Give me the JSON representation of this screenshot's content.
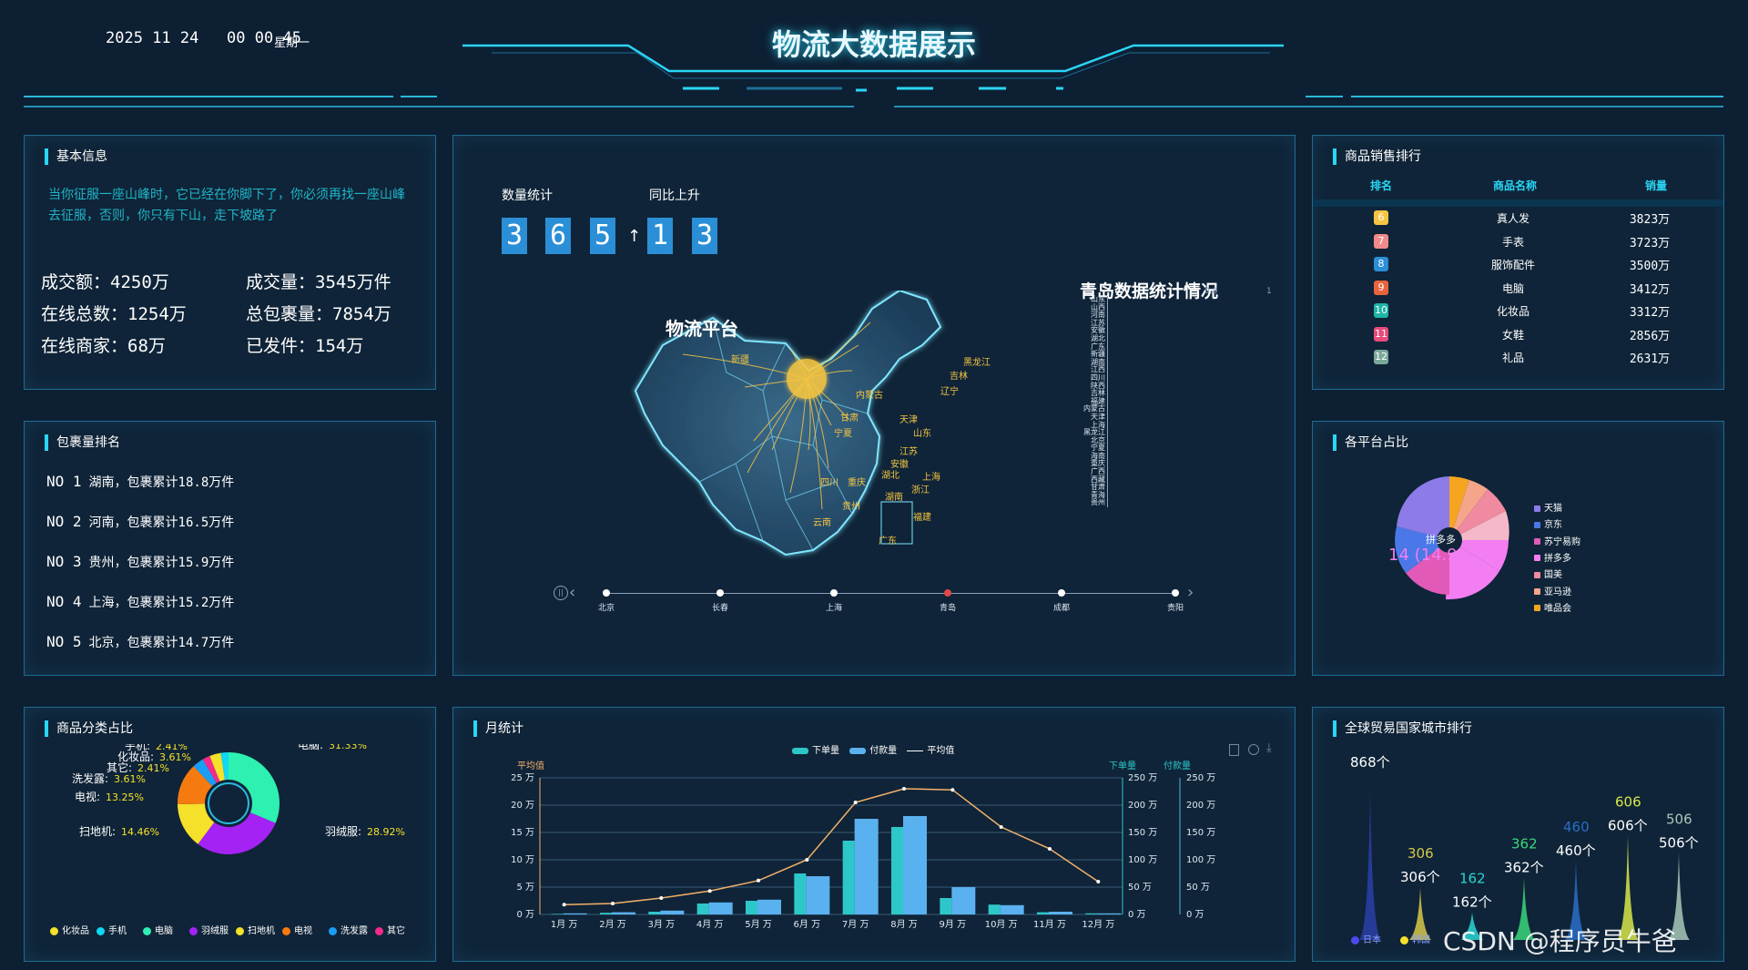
{
  "header": {
    "datetime": "2025 11 24   00 00 45",
    "weekday": "星期一",
    "title": "物流大数据展示"
  },
  "basic_info": {
    "title": "基本信息",
    "quote": "当你征服一座山峰时，它已经在你脚下了，你必须再找一座山峰去征服，否则，你只有下山，走下坡路了",
    "items": [
      {
        "label": "成交额：",
        "value": "4250",
        "unit": "万"
      },
      {
        "label": "成交量：",
        "value": "3545",
        "unit": "万件"
      },
      {
        "label": "在线总数：",
        "value": "1254",
        "unit": "万"
      },
      {
        "label": "总包裹量：",
        "value": "7854",
        "unit": "万"
      },
      {
        "label": "在线商家：",
        "value": "68",
        "unit": "万"
      },
      {
        "label": "已发件：",
        "value": "154",
        "unit": "万"
      }
    ]
  },
  "package_rank": {
    "title": "包裹量排名",
    "items": [
      {
        "no": "NO 1",
        "text": "湖南，包裹累计",
        "value": "18.8",
        "unit": "万件"
      },
      {
        "no": "NO 2",
        "text": "河南，包裹累计",
        "value": "16.5",
        "unit": "万件"
      },
      {
        "no": "NO 3",
        "text": "贵州，包裹累计",
        "value": "15.9",
        "unit": "万件"
      },
      {
        "no": "NO 4",
        "text": "上海，包裹累计",
        "value": "15.2",
        "unit": "万件"
      },
      {
        "no": "NO 5",
        "text": "北京，包裹累计",
        "value": "14.7",
        "unit": "万件"
      }
    ]
  },
  "center": {
    "count_label": "数量统计",
    "yoy_label": "同比上升",
    "count_digits": [
      "3",
      "6",
      "5"
    ],
    "arrow": "↑",
    "yoy_digits": [
      "1",
      "3"
    ],
    "map_title": "物流平台",
    "stat_title": "青岛数据统计情况",
    "axis_values": [
      "0.8",
      "1"
    ],
    "provinces": [
      "山东",
      "山西",
      "河南",
      "江苏",
      "安徽",
      "湖北",
      "广东",
      "新疆",
      "湖南",
      "江西",
      "四川",
      "陕西",
      "吉林",
      "福建",
      "内蒙古",
      "天津",
      "上海",
      "黑龙江",
      "北京",
      "宁夏",
      "海南",
      "重庆",
      "广西",
      "西藏",
      "甘肃",
      "青海",
      "贵州"
    ],
    "timeline": [
      "北京",
      "长春",
      "上海",
      "青岛",
      "成都",
      "贵阳"
    ],
    "timeline_active": 3,
    "cities": [
      "新疆",
      "内蒙古",
      "宁夏",
      "吉林",
      "辽宁",
      "黑龙江",
      "甘肃",
      "四川",
      "重庆",
      "湖北",
      "湖南",
      "贵州",
      "云南",
      "上海",
      "浙江",
      "福建",
      "广东",
      "安徽",
      "江苏",
      "山东",
      "天津"
    ]
  },
  "sales_rank": {
    "title": "商品销售排行",
    "headers": [
      "排名",
      "商品名称",
      "销量"
    ],
    "rows": [
      {
        "rank": "6",
        "name": "真人发",
        "sales": "3823万",
        "color": "#f5c542"
      },
      {
        "rank": "7",
        "name": "手表",
        "sales": "3723万",
        "color": "#f08a8a"
      },
      {
        "rank": "8",
        "name": "服饰配件",
        "sales": "3500万",
        "color": "#2a8fd6"
      },
      {
        "rank": "9",
        "name": "电脑",
        "sales": "3412万",
        "color": "#e8643c"
      },
      {
        "rank": "10",
        "name": "化妆品",
        "sales": "3312万",
        "color": "#1fb5a8"
      },
      {
        "rank": "11",
        "name": "女鞋",
        "sales": "2856万",
        "color": "#e84a7a"
      },
      {
        "rank": "12",
        "name": "礼品",
        "sales": "2631万",
        "color": "#7aa89a"
      }
    ]
  },
  "platform_share": {
    "title": "各平台占比",
    "center_label": "拼多多",
    "center_value": "14 (14.9%)",
    "legend": [
      {
        "name": "天猫",
        "color": "#8c7be8"
      },
      {
        "name": "京东",
        "color": "#4a78e8"
      },
      {
        "name": "苏宁易购",
        "color": "#e25ab8"
      },
      {
        "name": "拼多多",
        "color": "#f27ef2"
      },
      {
        "name": "国美",
        "color": "#f08aa0"
      },
      {
        "name": "亚马逊",
        "color": "#f5a58a"
      },
      {
        "name": "唯品会",
        "color": "#f5a520"
      }
    ]
  },
  "category_share": {
    "title": "商品分类占比",
    "chart_data": {
      "type": "pie",
      "labels": [
        "电脑",
        "羽绒服",
        "扫地机",
        "电视",
        "洗发露",
        "其它",
        "化妆品",
        "手机"
      ],
      "values": [
        31.33,
        28.92,
        14.46,
        13.25,
        3.61,
        2.41,
        3.61,
        2.41
      ],
      "value_labels": [
        "31.33%",
        "28.92%",
        "14.46%",
        "13.25%",
        "3.61%",
        "2.41%",
        "3.61%",
        "2.41%"
      ],
      "colors": [
        "#2ef0b0",
        "#a522f5",
        "#f5e02a",
        "#f57a10",
        "#1a9ef5",
        "#f52a8c",
        "#f5e02a",
        "#10d8f5"
      ]
    },
    "legend": [
      {
        "name": "化妆品",
        "color": "#f5e02a"
      },
      {
        "name": "手机",
        "color": "#10d8f5"
      },
      {
        "name": "电脑",
        "color": "#2ef0b0"
      },
      {
        "name": "羽绒服",
        "color": "#a522f5"
      },
      {
        "name": "扫地机",
        "color": "#f5e02a"
      },
      {
        "name": "电视",
        "color": "#f57a10"
      },
      {
        "name": "洗发露",
        "color": "#1a9ef5"
      },
      {
        "name": "其它",
        "color": "#f52a8c"
      }
    ]
  },
  "monthly": {
    "title": "月统计",
    "legend": [
      "下单量",
      "付款量",
      "平均值"
    ],
    "axis_names": [
      "平均值",
      "下单量",
      "付款量"
    ],
    "left_ticks": [
      "25 万",
      "20 万",
      "15 万",
      "10 万",
      "5 万",
      "0 万"
    ],
    "right_ticks": [
      "250 万",
      "200 万",
      "150 万",
      "100 万",
      "50 万",
      "0 万"
    ],
    "chart_data": {
      "type": "bar",
      "categories": [
        "1月 万",
        "2月 万",
        "3月 万",
        "4月 万",
        "5月 万",
        "6月 万",
        "7月 万",
        "8月 万",
        "9月 万",
        "10月 万",
        "11月 万",
        "12月 万"
      ],
      "series": [
        {
          "name": "下单量",
          "values": [
            1,
            3,
            5,
            20,
            25,
            75,
            135,
            160,
            30,
            18,
            4,
            2
          ]
        },
        {
          "name": "付款量",
          "values": [
            2,
            4,
            7,
            22,
            27,
            70,
            175,
            180,
            50,
            17,
            5,
            2
          ]
        },
        {
          "name": "平均值",
          "values": [
            1.8,
            2,
            3,
            4.3,
            6.2,
            10,
            20.5,
            23,
            22.8,
            16,
            12,
            6
          ]
        }
      ],
      "ylim_left": [
        0,
        25
      ],
      "ylim_right": [
        0,
        250
      ],
      "colors": [
        "#2ec7c9",
        "#5ab1ef",
        "#f5b06a"
      ]
    }
  },
  "global_trade": {
    "title": "全球贸易国家城市排行",
    "chart_data": {
      "type": "bar",
      "categories": [
        "日本",
        "韩国",
        "",
        "",
        "",
        "",
        "",
        ""
      ],
      "values": [
        868,
        306,
        162,
        362,
        460,
        606,
        506
      ],
      "value_labels": [
        "868个",
        "306个",
        "162个",
        "362个",
        "460个",
        "606个",
        "506个"
      ],
      "top_labels": [
        "",
        "306",
        "162",
        "362",
        "460",
        "606",
        "506"
      ],
      "colors": [
        "#2a3fa8",
        "#d8c84a",
        "#2ad6d6",
        "#3ad67a",
        "#2a6fc8",
        "#d8e84a",
        "#a8c8b8"
      ]
    },
    "legend": [
      {
        "name": "日本",
        "color": "#4a4af0"
      },
      {
        "name": "韩国",
        "color": "#f5e02a"
      }
    ]
  },
  "watermark": "CSDN @程序员牛爸"
}
